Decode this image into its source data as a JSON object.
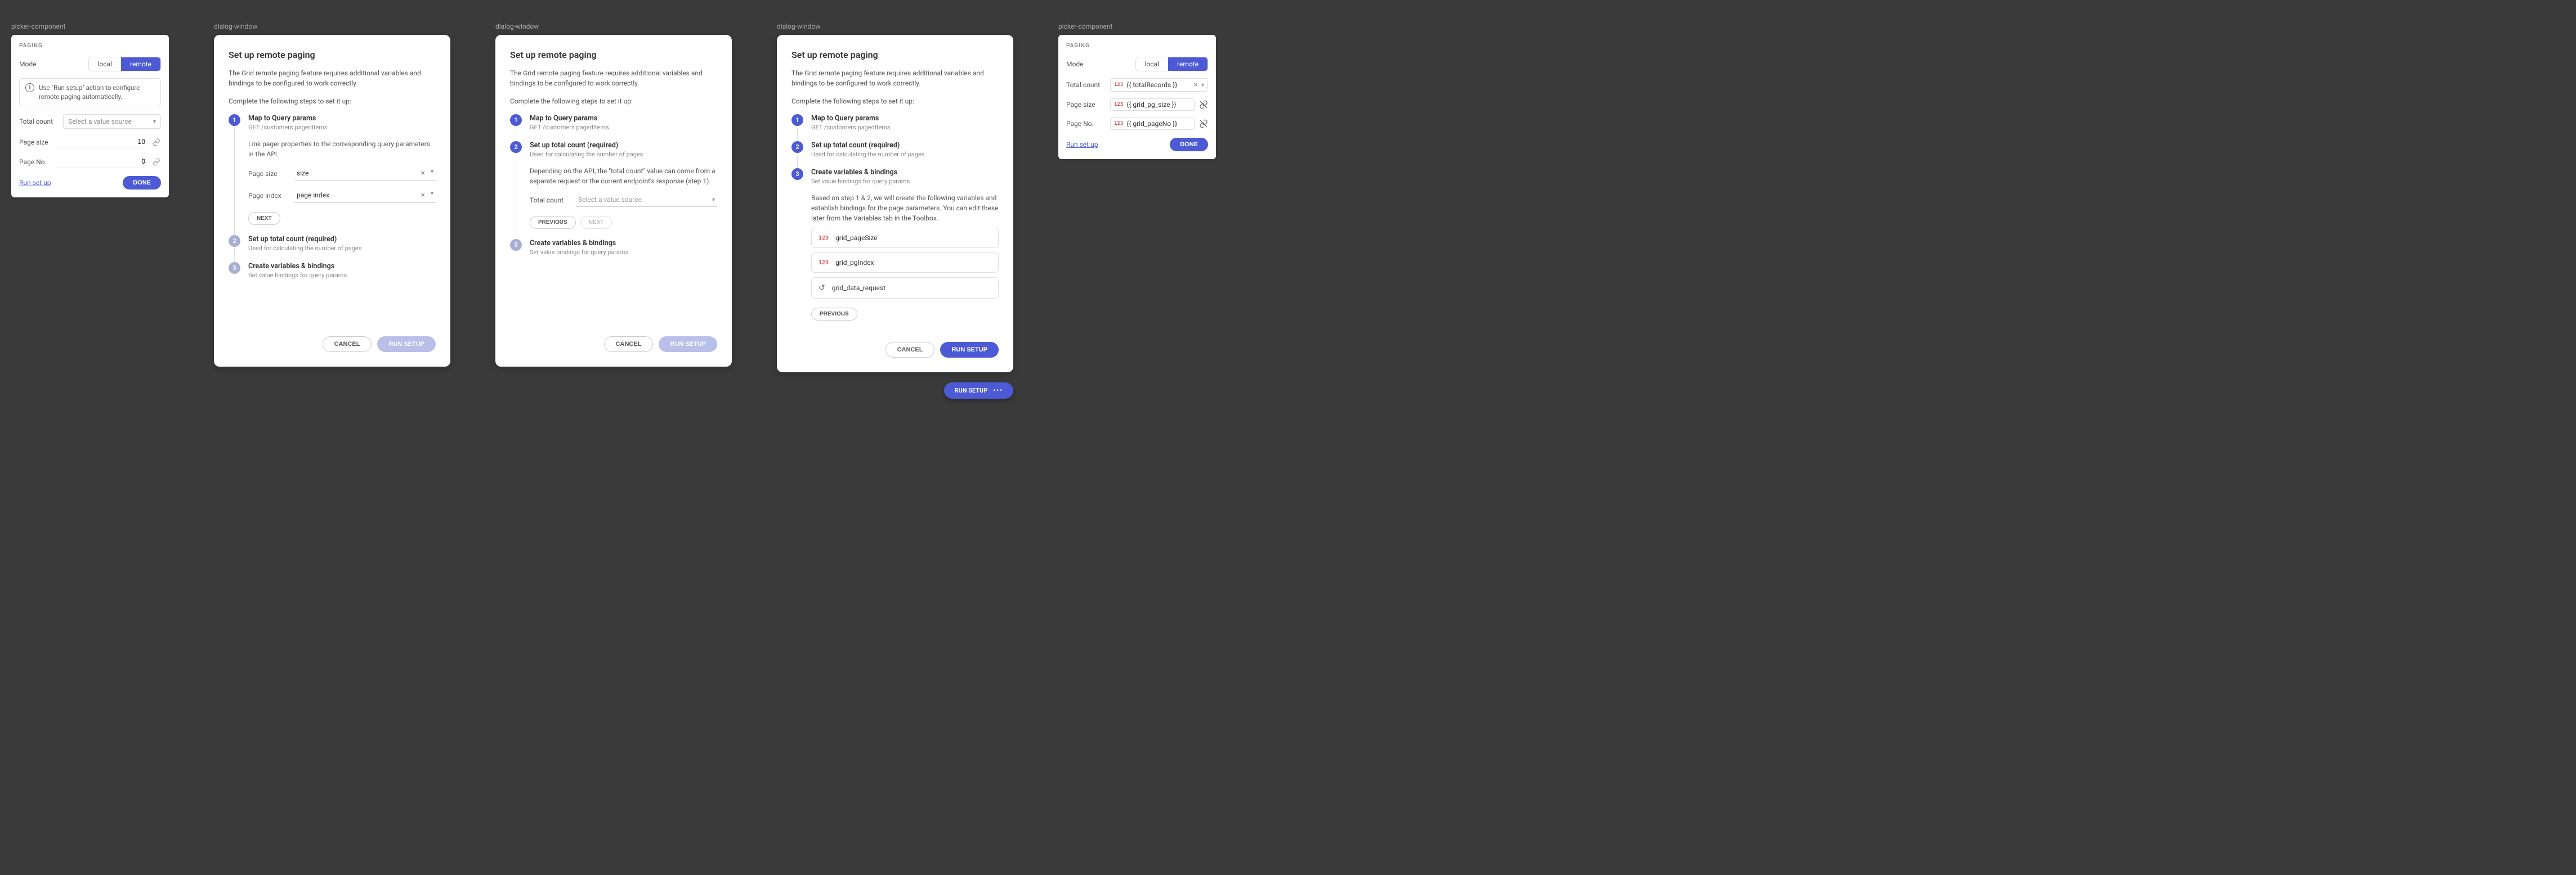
{
  "labels": {
    "picker_component": "picker-component",
    "dialog_window": "dialog-window"
  },
  "picker": {
    "section_title": "PAGING",
    "mode_label": "Mode",
    "mode_local": "local",
    "mode_remote": "remote",
    "info_text": "Use \"Run setup\" action to configure remote paging automatically.",
    "total_count_label": "Total count",
    "total_count_placeholder": "Select a value source",
    "page_size_label": "Page size",
    "page_size_value": "10",
    "page_no_label": "Page No.",
    "page_no_value": "0",
    "run_setup_link": "Run set up",
    "done": "DONE"
  },
  "picker_bound": {
    "total_count_value": "{{ totalRecords }}",
    "page_size_value": "{{ grid_pg_size }}",
    "page_no_value": "{{ grid_pageNo }}"
  },
  "dialog": {
    "title": "Set up remote paging",
    "desc": "The Grid remote paging feature requires additional variables and bindings to be configured to work correctly.",
    "instruction": "Complete the following steps to set it up:",
    "steps": {
      "s1": {
        "title": "Map to Query params",
        "sub": "GET /customers.pagedItems",
        "content_text": "Link pager properties to the corresponding query parameters in the API.",
        "page_size_label": "Page size",
        "page_size_val": "size",
        "page_index_label": "Page index",
        "page_index_val": "page index"
      },
      "s2": {
        "title": "Set up total count (required)",
        "sub": "Used for calculating the number of pages",
        "sub_alt": "Used for calculating the number of pages.",
        "content_text": "Depending on the API, the \"total count\" value can come from a separate request or the current endpoint's response (step 1).",
        "total_count_label": "Total count",
        "total_count_placeholder": "Select a value source"
      },
      "s3": {
        "title": "Create variables & bindings",
        "sub": "Set value bindings for query params",
        "content_text": "Based on step 1 & 2, we will create the following variables and establish bindings for the page parameters. You can edit these later from the Variables tab in the Toolbox.",
        "var1": "grid_pageSize",
        "var2": "grid_pgIndex",
        "var3": "grid_data_request"
      }
    },
    "nav": {
      "next": "NEXT",
      "previous": "PREVIOUS"
    },
    "footer": {
      "cancel": "CANCEL",
      "run_setup": "RUN SETUP"
    }
  },
  "chip": {
    "label": "RUN SETUP"
  }
}
